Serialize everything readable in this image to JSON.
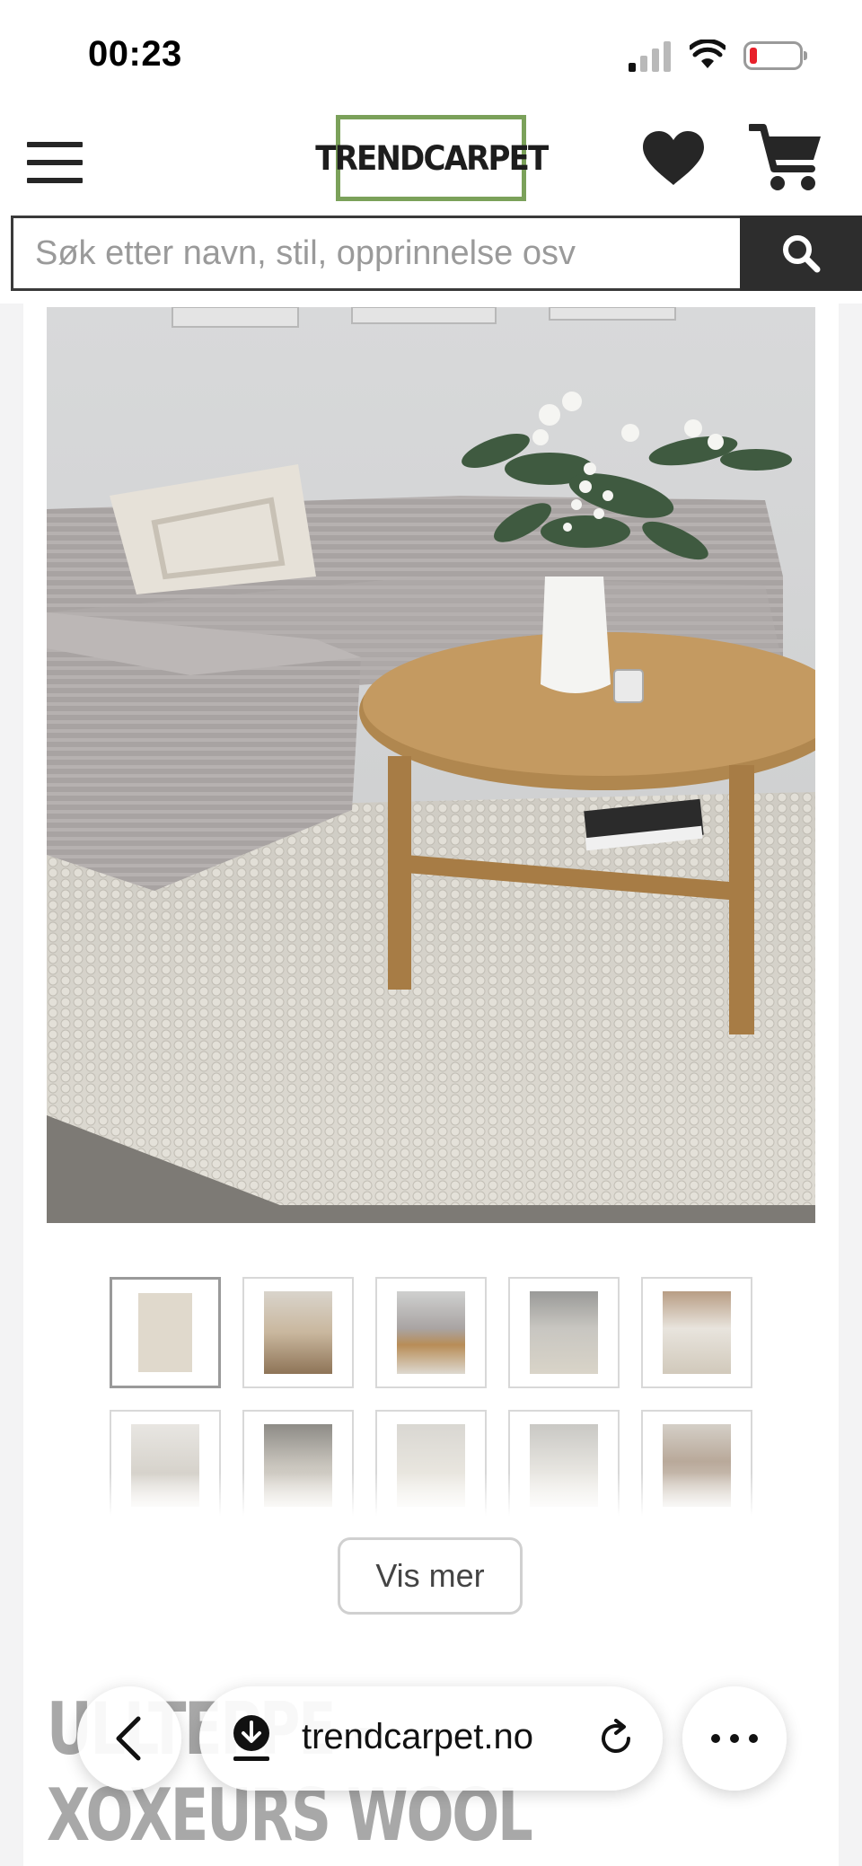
{
  "status_bar": {
    "time": "00:23",
    "signal_icon": "cellular-signal-icon",
    "wifi_icon": "wifi-icon",
    "battery_icon": "battery-low-icon",
    "battery_color": "#e8202a"
  },
  "header": {
    "menu_icon": "hamburger-menu-icon",
    "logo_text": "TRENDCARPET",
    "logo_border_color": "#7ba15a",
    "wishlist_icon": "heart-icon",
    "cart_icon": "shopping-cart-icon"
  },
  "search": {
    "placeholder": "Søk etter navn, stil, opprinnelse osv",
    "value": "",
    "button_icon": "search-icon"
  },
  "gallery": {
    "main_image": "living room with grey corduroy sofa, round oak coffee table with flowers in white vase, and beige wool bubble rug",
    "thumbnails": [
      {
        "description": "beige rug product shot",
        "selected": true
      },
      {
        "description": "room with rug and wooden furniture",
        "selected": false
      },
      {
        "description": "sofa and coffee table on rug",
        "selected": false
      },
      {
        "description": "rug with striped border near door",
        "selected": false
      },
      {
        "description": "living room with sofa and rug",
        "selected": false
      },
      {
        "description": "bright living room with white sofa",
        "selected": false
      },
      {
        "description": "rug close-up with furniture",
        "selected": false
      },
      {
        "description": "dining area with rug",
        "selected": false
      },
      {
        "description": "bright room with rug",
        "selected": false
      },
      {
        "description": "sofa with cushions on rug",
        "selected": false
      }
    ],
    "show_more_label": "Vis mer"
  },
  "product": {
    "title": "ULLTEPPE - XOXEURS WOOL\nBUBBLE (BEIGE)"
  },
  "browser": {
    "back_icon": "chevron-left-icon",
    "download_icon": "download-icon",
    "url": "trendcarpet.no",
    "reload_icon": "reload-icon",
    "more_icon": "more-dots-icon"
  }
}
